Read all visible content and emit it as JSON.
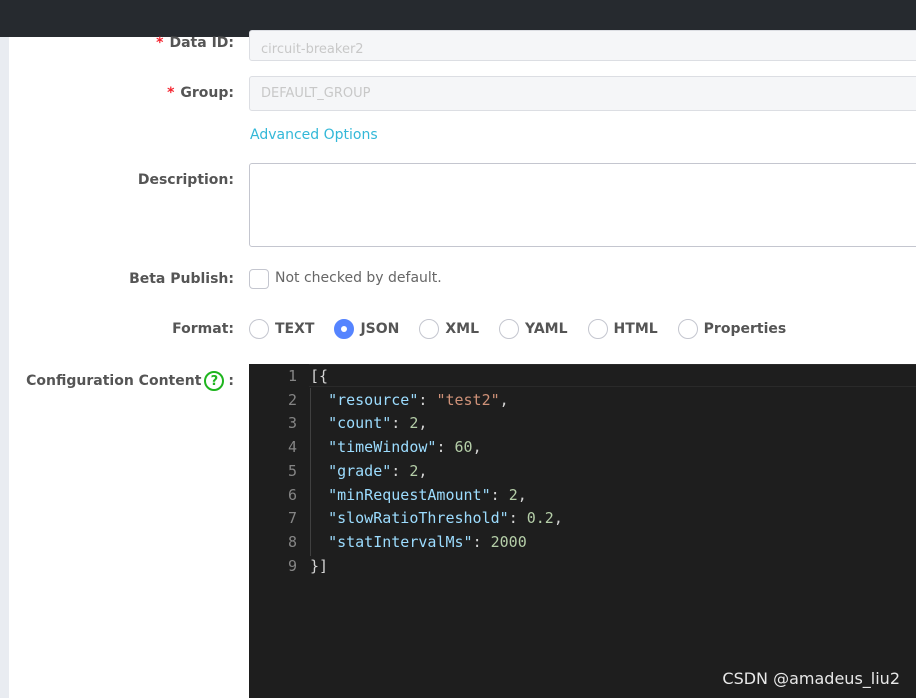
{
  "form": {
    "data_id": {
      "label": "Data ID:",
      "value": "circuit-breaker2"
    },
    "group": {
      "label": "Group:",
      "value": "DEFAULT_GROUP"
    },
    "required_mark": "*",
    "advanced_options": "Advanced Options",
    "description": {
      "label": "Description:",
      "value": ""
    },
    "beta_publish": {
      "label": "Beta Publish:",
      "text": "Not checked by default.",
      "checked": false
    },
    "format": {
      "label": "Format:",
      "options": [
        "TEXT",
        "JSON",
        "XML",
        "YAML",
        "HTML",
        "Properties"
      ],
      "selected": "JSON"
    },
    "config_content": {
      "label": "Configuration Content",
      "help_icon": "question-circle-icon",
      "colon": ":"
    }
  },
  "editor": {
    "lines": [
      {
        "n": "1",
        "tokens": [
          {
            "t": "[{",
            "c": "p"
          }
        ]
      },
      {
        "n": "2",
        "tokens": [
          {
            "t": "  ",
            "c": "p"
          },
          {
            "t": "\"resource\"",
            "c": "k"
          },
          {
            "t": ": ",
            "c": "p"
          },
          {
            "t": "\"test2\"",
            "c": "s"
          },
          {
            "t": ",",
            "c": "p"
          }
        ]
      },
      {
        "n": "3",
        "tokens": [
          {
            "t": "  ",
            "c": "p"
          },
          {
            "t": "\"count\"",
            "c": "k"
          },
          {
            "t": ": ",
            "c": "p"
          },
          {
            "t": "2",
            "c": "n"
          },
          {
            "t": ",",
            "c": "p"
          }
        ]
      },
      {
        "n": "4",
        "tokens": [
          {
            "t": "  ",
            "c": "p"
          },
          {
            "t": "\"timeWindow\"",
            "c": "k"
          },
          {
            "t": ": ",
            "c": "p"
          },
          {
            "t": "60",
            "c": "n"
          },
          {
            "t": ",",
            "c": "p"
          }
        ]
      },
      {
        "n": "5",
        "tokens": [
          {
            "t": "  ",
            "c": "p"
          },
          {
            "t": "\"grade\"",
            "c": "k"
          },
          {
            "t": ": ",
            "c": "p"
          },
          {
            "t": "2",
            "c": "n"
          },
          {
            "t": ",",
            "c": "p"
          }
        ]
      },
      {
        "n": "6",
        "tokens": [
          {
            "t": "  ",
            "c": "p"
          },
          {
            "t": "\"minRequestAmount\"",
            "c": "k"
          },
          {
            "t": ": ",
            "c": "p"
          },
          {
            "t": "2",
            "c": "n"
          },
          {
            "t": ",",
            "c": "p"
          }
        ]
      },
      {
        "n": "7",
        "tokens": [
          {
            "t": "  ",
            "c": "p"
          },
          {
            "t": "\"slowRatioThreshold\"",
            "c": "k"
          },
          {
            "t": ": ",
            "c": "p"
          },
          {
            "t": "0.2",
            "c": "n"
          },
          {
            "t": ",",
            "c": "p"
          }
        ]
      },
      {
        "n": "8",
        "tokens": [
          {
            "t": "  ",
            "c": "p"
          },
          {
            "t": "\"statIntervalMs\"",
            "c": "k"
          },
          {
            "t": ": ",
            "c": "p"
          },
          {
            "t": "2000",
            "c": "n"
          }
        ]
      },
      {
        "n": "9",
        "tokens": [
          {
            "t": "}]",
            "c": "p"
          }
        ]
      }
    ]
  },
  "watermark": "CSDN @amadeus_liu2",
  "colors": {
    "topbar": "#262a2f",
    "link": "#33b8d8",
    "radio_selected": "#5584ff",
    "required": "#f5222d",
    "help": "#1fb51f",
    "editor_bg": "#1e1e1e"
  }
}
